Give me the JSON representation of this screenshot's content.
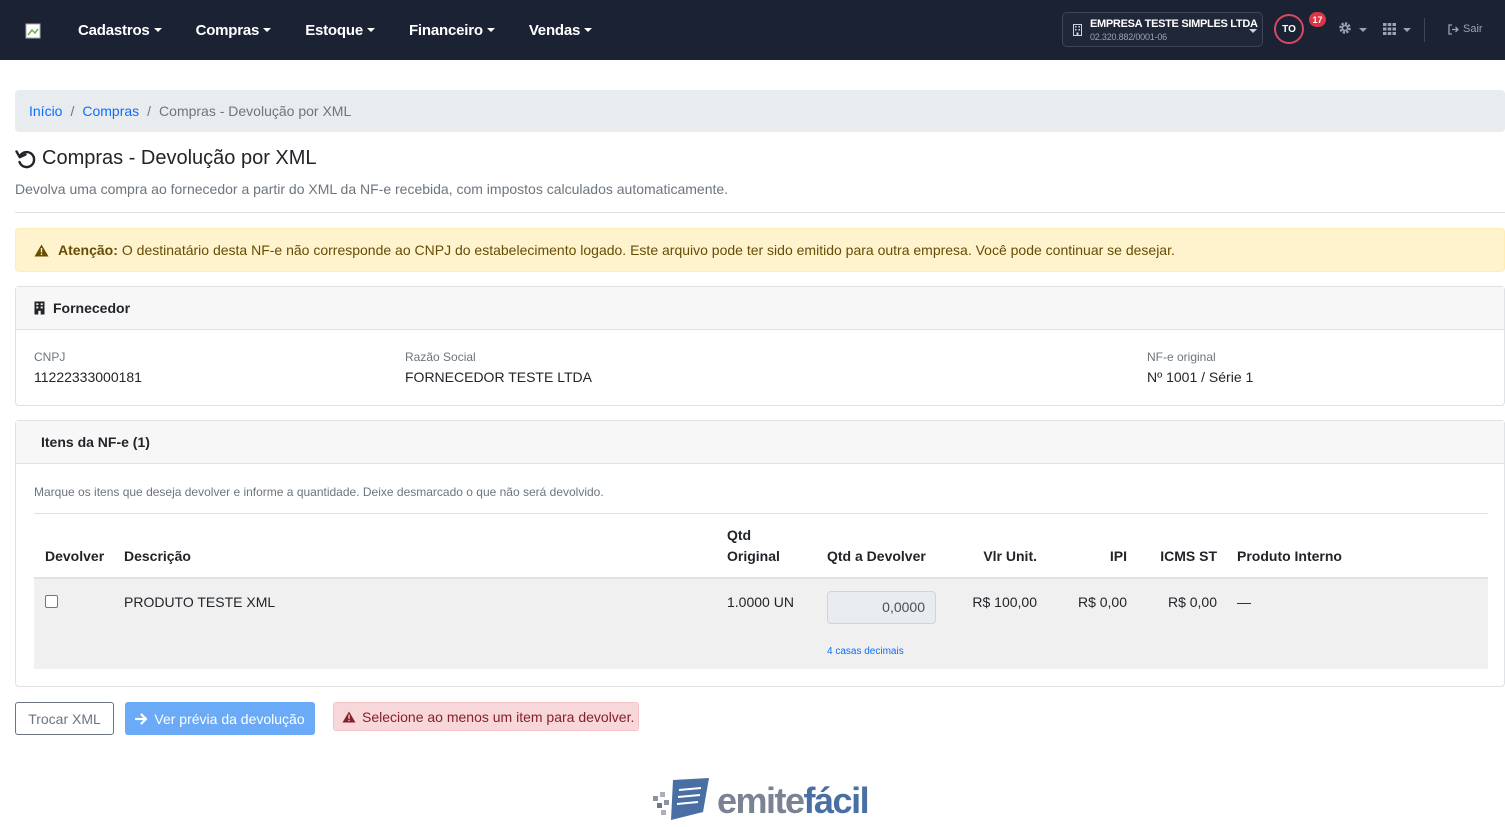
{
  "nav": {
    "menu": [
      "Cadastros",
      "Compras",
      "Estoque",
      "Financeiro",
      "Vendas"
    ],
    "company_name": "EMPRESA TESTE SIMPLES LTDA",
    "company_cnpj": "02.320.882/0001-06",
    "avatar_initials": "TO",
    "notification_count": "17",
    "logout_label": "Sair"
  },
  "breadcrumb": {
    "home": "Início",
    "section": "Compras",
    "current": "Compras - Devolução por XML"
  },
  "page": {
    "title": "Compras - Devolução por XML",
    "subtitle": "Devolva uma compra ao fornecedor a partir do XML da NF-e recebida, com impostos calculados automaticamente."
  },
  "warning": {
    "strong": "Atenção:",
    "text": "O destinatário desta NF-e não corresponde ao CNPJ do estabelecimento logado. Este arquivo pode ter sido emitido para outra empresa. Você pode continuar se desejar."
  },
  "supplier": {
    "header": "Fornecedor",
    "cnpj_label": "CNPJ",
    "cnpj_value": "11222333000181",
    "name_label": "Razão Social",
    "name_value": "FORNECEDOR TESTE LTDA",
    "nfe_label": "NF-e original",
    "nfe_value": "Nº 1001 / Série 1"
  },
  "items": {
    "header": "Itens da NF-e (1)",
    "help": "Marque os itens que deseja devolver e informe a quantidade. Deixe desmarcado o que não será devolvido.",
    "columns": {
      "devolver": "Devolver",
      "descricao": "Descrição",
      "qtd_original_1": "Qtd",
      "qtd_original_2": "Original",
      "qtd_devolver": "Qtd a Devolver",
      "vlr_unit": "Vlr Unit.",
      "ipi": "IPI",
      "icms_st": "ICMS ST",
      "produto_interno": "Produto Interno"
    },
    "rows": [
      {
        "checked": false,
        "descricao": "PRODUTO TESTE XML",
        "qtd_original": "1.0000 UN",
        "qtd_devolver": "0,0000",
        "hint": "4 casas decimais",
        "vlr_unit": "R$ 100,00",
        "ipi": "R$ 0,00",
        "icms_st": "R$ 0,00",
        "produto_interno": "—"
      }
    ]
  },
  "actions": {
    "swap_xml": "Trocar XML",
    "preview": "Ver prévia da devolução",
    "error": "Selecione ao menos um item para devolver."
  },
  "footer": {
    "brand_part1": "emite",
    "brand_part2": "fácil"
  },
  "colors": {
    "navbar": "#1b2233",
    "link": "#0d6efd",
    "warning_bg": "#fff3cd",
    "danger_bg": "#f8d7da",
    "primary_disabled": "#6aaaf7"
  }
}
